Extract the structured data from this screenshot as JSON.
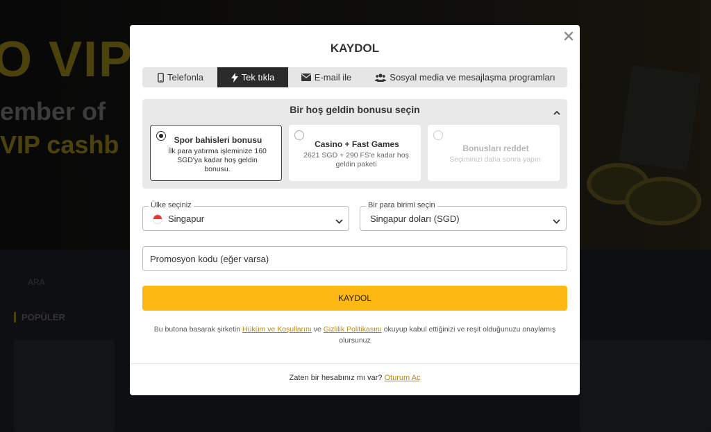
{
  "modal": {
    "title": "KAYDOL",
    "close_icon": "close-icon"
  },
  "tabs": [
    {
      "label": "Telefonla",
      "icon": "phone-icon",
      "active": false
    },
    {
      "label": "Tek tıkla",
      "icon": "lightning-icon",
      "active": true
    },
    {
      "label": "E-mail ile",
      "icon": "envelope-icon",
      "active": false
    },
    {
      "label": "Sosyal media ve mesajlaşma programları",
      "icon": "users-icon",
      "active": false
    }
  ],
  "bonus": {
    "heading": "Bir hoş geldin bonusu seçin",
    "cards": [
      {
        "title": "Spor bahisleri bonusu",
        "description": "İlk para yatırma işleminize 160 SGD'ya kadar hoş geldin bonusu.",
        "selected": true
      },
      {
        "title": "Casino + Fast Games",
        "description": "2621 SGD + 290 FS'e kadar hoş geldin paketi",
        "selected": false
      },
      {
        "title": "Bonusları reddet",
        "description": "Seçiminizi daha sonra yapın",
        "selected": false
      }
    ]
  },
  "country": {
    "label": "Ülke seçiniz",
    "value": "Singapur",
    "flag": "singapore-flag"
  },
  "currency": {
    "label": "Bir para birimi seçin",
    "value": "Singapur doları (SGD)"
  },
  "promo": {
    "placeholder": "Promosyon kodu (eğer varsa)"
  },
  "submit": {
    "label": "KAYDOL"
  },
  "terms": {
    "prefix": "Bu butona basarak şirketin",
    "link1": "Hüküm ve Koşullarını",
    "middle": "ve",
    "link2": "Gizlilik Politikasını",
    "suffix": "okuyup kabul ettiğinizi ve reşit olduğunuzu onaylamış olursunuz"
  },
  "login": {
    "prompt": "Zaten bir hesabınız mı var?",
    "link": "Oturum Aç"
  },
  "background": {
    "banner_line1": "O VIP",
    "banner_line2": "ember of",
    "banner_line3": "VIP cashb",
    "search": "ARA",
    "popular": "POPÜLER"
  },
  "colors": {
    "accent": "#fdb813",
    "active_tab": "#2b2b2b",
    "link": "#b8860b"
  }
}
